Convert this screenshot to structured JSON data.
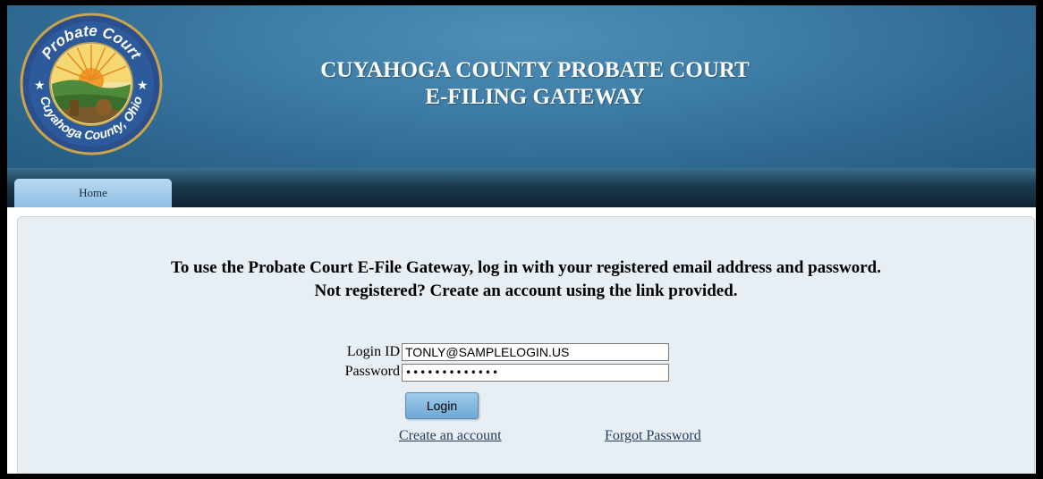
{
  "header": {
    "title_line1": "CUYAHOGA COUNTY PROBATE COURT",
    "title_line2": "E-FILING GATEWAY",
    "seal": {
      "top_text": "Probate Court",
      "bottom_text": "Cuyahoga County, Ohio"
    }
  },
  "nav": {
    "tabs": [
      {
        "label": "Home",
        "active": true
      }
    ]
  },
  "main": {
    "intro_line1": "To use the Probate Court E-File Gateway, log in with your registered email address and password.",
    "intro_line2": "Not registered? Create an account using the link provided.",
    "login_id_label": "Login ID",
    "login_id_value": "TONLY@SAMPLELOGIN.US",
    "password_label": "Password",
    "password_value": "•••••••••••••",
    "login_button": "Login",
    "create_account_link": "Create an account",
    "forgot_password_link": "Forgot Password"
  },
  "colors": {
    "header_blue": "#3e7ea7",
    "nav_dark": "#1b3a4f",
    "tab_light_blue": "#8fc0e6",
    "content_bg": "#e8eff4",
    "link_color": "#1f3a5a"
  }
}
